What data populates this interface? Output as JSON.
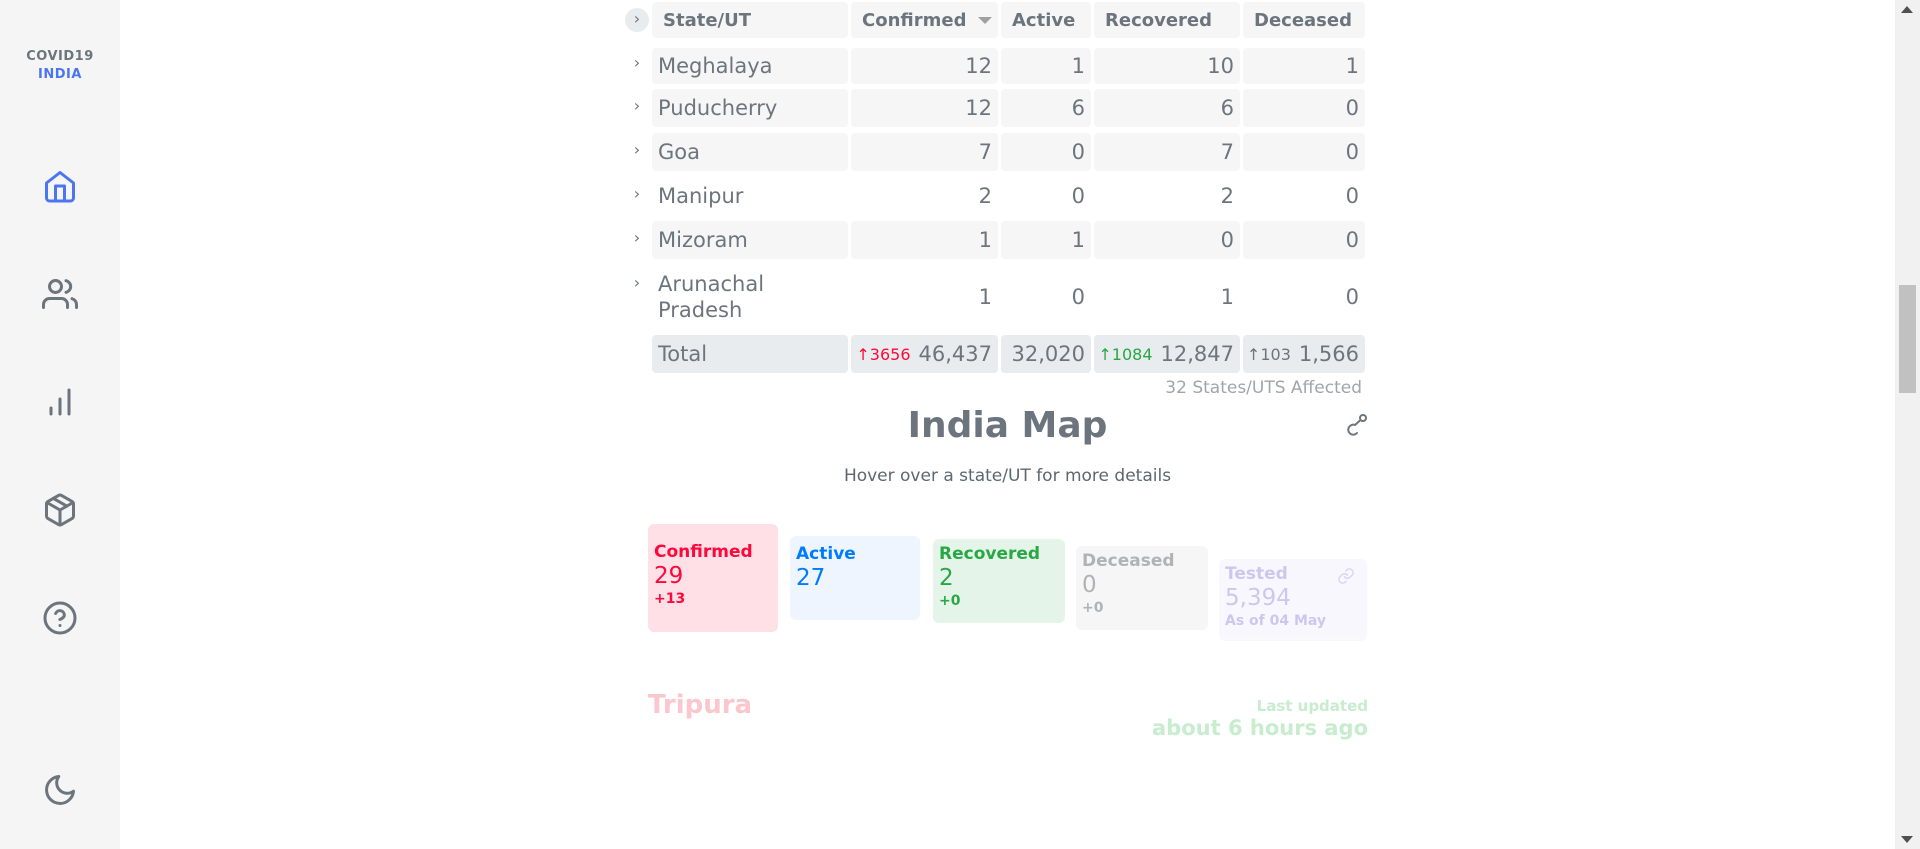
{
  "sidebar": {
    "logo_line1": "COVID19",
    "logo_line2": "INDIA",
    "nav": [
      "home-icon",
      "users-icon",
      "bar-chart-icon",
      "package-icon",
      "help-icon"
    ],
    "theme_icon": "moon-icon"
  },
  "table": {
    "headers": {
      "state": "State/UT",
      "confirmed": "Confirmed",
      "active": "Active",
      "recovered": "Recovered",
      "deceased": "Deceased"
    },
    "rows": [
      {
        "state": "Meghalaya",
        "confirmed": "12",
        "active": "1",
        "recovered": "10",
        "deceased": "1"
      },
      {
        "state": "Puducherry",
        "confirmed": "12",
        "active": "6",
        "recovered": "6",
        "deceased": "0"
      },
      {
        "state": "Goa",
        "confirmed": "7",
        "active": "0",
        "recovered": "7",
        "deceased": "0"
      },
      {
        "state": "Manipur",
        "confirmed": "2",
        "active": "0",
        "recovered": "2",
        "deceased": "0"
      },
      {
        "state": "Mizoram",
        "confirmed": "1",
        "active": "1",
        "recovered": "0",
        "deceased": "0"
      },
      {
        "state": "Arunachal Pradesh",
        "confirmed": "1",
        "active": "0",
        "recovered": "1",
        "deceased": "0"
      }
    ],
    "total": {
      "label": "Total",
      "confirmed_delta": "↑3656",
      "confirmed": "46,437",
      "active": "32,020",
      "recovered_delta": "↑1084",
      "recovered": "12,847",
      "deceased_delta": "↑103",
      "deceased": "1,566"
    },
    "affected": "32 States/UTS Affected"
  },
  "map": {
    "title": "India Map",
    "subtitle": "Hover over a state/UT for more details",
    "share_icon": "share-icon"
  },
  "stats": {
    "confirmed": {
      "label": "Confirmed",
      "value": "29",
      "delta": "+13"
    },
    "active": {
      "label": "Active",
      "value": "27"
    },
    "recovered": {
      "label": "Recovered",
      "value": "2",
      "delta": "+0"
    },
    "deceased": {
      "label": "Deceased",
      "value": "0",
      "delta": "+0"
    },
    "tested": {
      "label": "Tested",
      "value": "5,394",
      "date": "As of 04 May"
    }
  },
  "selected_state": {
    "name": "Tripura",
    "last_updated_label": "Last updated",
    "last_updated_value": "about 6 hours ago"
  },
  "colors": {
    "accent": "#4c75f2",
    "confirmed": "#ff073a",
    "active": "#007bff",
    "recovered": "#28a745",
    "deceased": "#6c757d"
  }
}
